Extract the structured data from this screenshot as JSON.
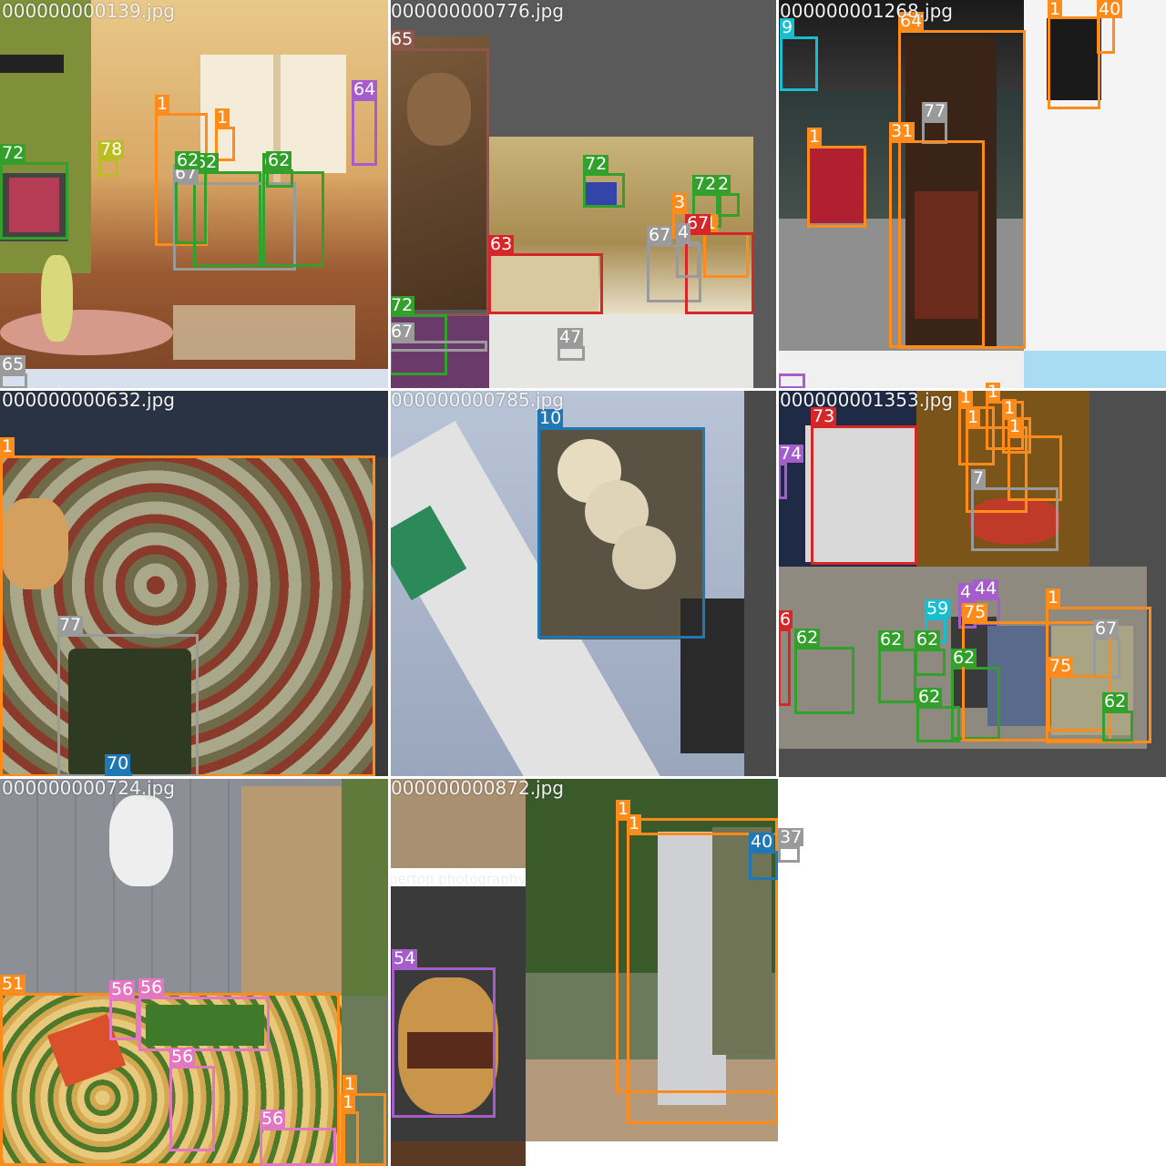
{
  "tiles": [
    {
      "filename": "000000000139.jpg",
      "labels": [
        "1",
        "1",
        "64",
        "72",
        "78",
        "62",
        "67",
        "66",
        "62",
        "62",
        "65"
      ]
    },
    {
      "filename": "000000000776.jpg",
      "labels": [
        "65",
        "72",
        "63",
        "67",
        "3",
        "1",
        "72",
        "2",
        "67",
        "4",
        "72",
        "67",
        "47"
      ]
    },
    {
      "filename": "000000001268.jpg",
      "labels": [
        "1",
        "40",
        "9",
        "77",
        "1",
        "31",
        "64"
      ]
    },
    {
      "filename": "000000000632.jpg",
      "labels": [
        "1",
        "77",
        "70"
      ]
    },
    {
      "filename": "000000000785.jpg",
      "labels": [
        "10"
      ]
    },
    {
      "filename": "000000001353.jpg",
      "labels": [
        "73",
        "74",
        "1",
        "1",
        "1",
        "1",
        "1",
        "7",
        "44",
        "4",
        "1",
        "59",
        "62",
        "62",
        "62",
        "62",
        "62",
        "67",
        "75",
        "75",
        "62",
        "6"
      ]
    },
    {
      "filename": "000000000724.jpg",
      "labels": [
        "51",
        "56",
        "56",
        "56",
        "56",
        "1",
        "1"
      ]
    },
    {
      "filename": "000000000872.jpg",
      "labels": [
        "1",
        "1",
        "40",
        "37",
        "54"
      ],
      "watermark": "pertop photography"
    }
  ],
  "colors": {
    "person": "#ff8c1a",
    "green": "#33a02c",
    "gray": "#9a9a9a",
    "purple": "#a55dcc",
    "red": "#d62728",
    "blue": "#1f77b4",
    "pink": "#e377c2",
    "olive": "#bcbd22",
    "cyan": "#17becf",
    "brown": "#8c564b"
  }
}
